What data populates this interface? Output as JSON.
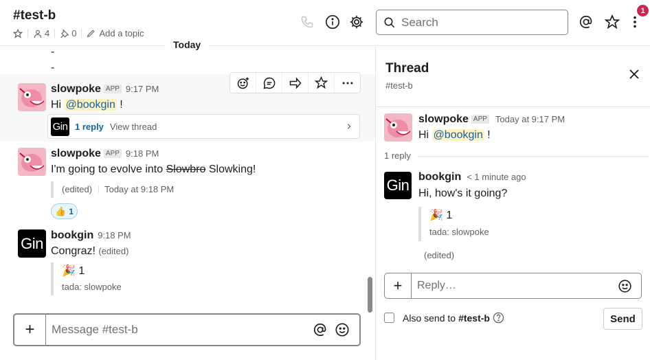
{
  "channel": {
    "name": "#test-b",
    "members": "4",
    "pins": "0",
    "add_topic": "Add a topic"
  },
  "search": {
    "placeholder": "Search"
  },
  "notifications": {
    "badge": "1"
  },
  "divider": {
    "label": "Today"
  },
  "messages": [
    {
      "dash1": "-",
      "dash2": "-"
    },
    {
      "sender": "slowpoke",
      "app_tag": "APP",
      "time": "9:17 PM",
      "text_prefix": "Hi ",
      "mention": "@bookgin",
      "text_suffix": " !",
      "reply_count": "1 reply",
      "view_thread": "View thread",
      "reply_avatar": "Gin"
    },
    {
      "sender": "slowpoke",
      "app_tag": "APP",
      "time": "9:18 PM",
      "text_prefix": "I'm going to evolve into ",
      "strike": "Slowbro",
      "text_suffix": " Slowking!",
      "edited": "(edited)",
      "edited_time": "Today at 9:18 PM",
      "reaction_emoji": "👍",
      "reaction_count": "1"
    },
    {
      "sender": "bookgin",
      "avatar": "Gin",
      "time": "9:18 PM",
      "text": "Congraz!",
      "edited": "(edited)",
      "reaction_emoji": "🎉",
      "reaction_count": "1",
      "reaction_info": "tada: slowpoke"
    }
  ],
  "composer": {
    "placeholder": "Message #test-b"
  },
  "thread": {
    "title": "Thread",
    "channel": "#test-b",
    "parent": {
      "sender": "slowpoke",
      "app_tag": "APP",
      "time": "Today at 9:17 PM",
      "text_prefix": "Hi ",
      "mention": "@bookgin",
      "text_suffix": " !"
    },
    "reply_count": "1 reply",
    "reply": {
      "sender": "bookgin",
      "avatar": "Gin",
      "time": "< 1 minute ago",
      "text": "Hi, how's it going?",
      "reaction_emoji": "🎉",
      "reaction_count": "1",
      "reaction_info": "tada: slowpoke",
      "edited": "(edited)"
    },
    "composer_placeholder": "Reply…",
    "also_send_prefix": "Also send to ",
    "also_send_channel": "#test-b",
    "send_label": "Send"
  },
  "colors": {
    "mention_bg": "#fff3c4",
    "link": "#1264a3",
    "badge": "#cd2553"
  }
}
